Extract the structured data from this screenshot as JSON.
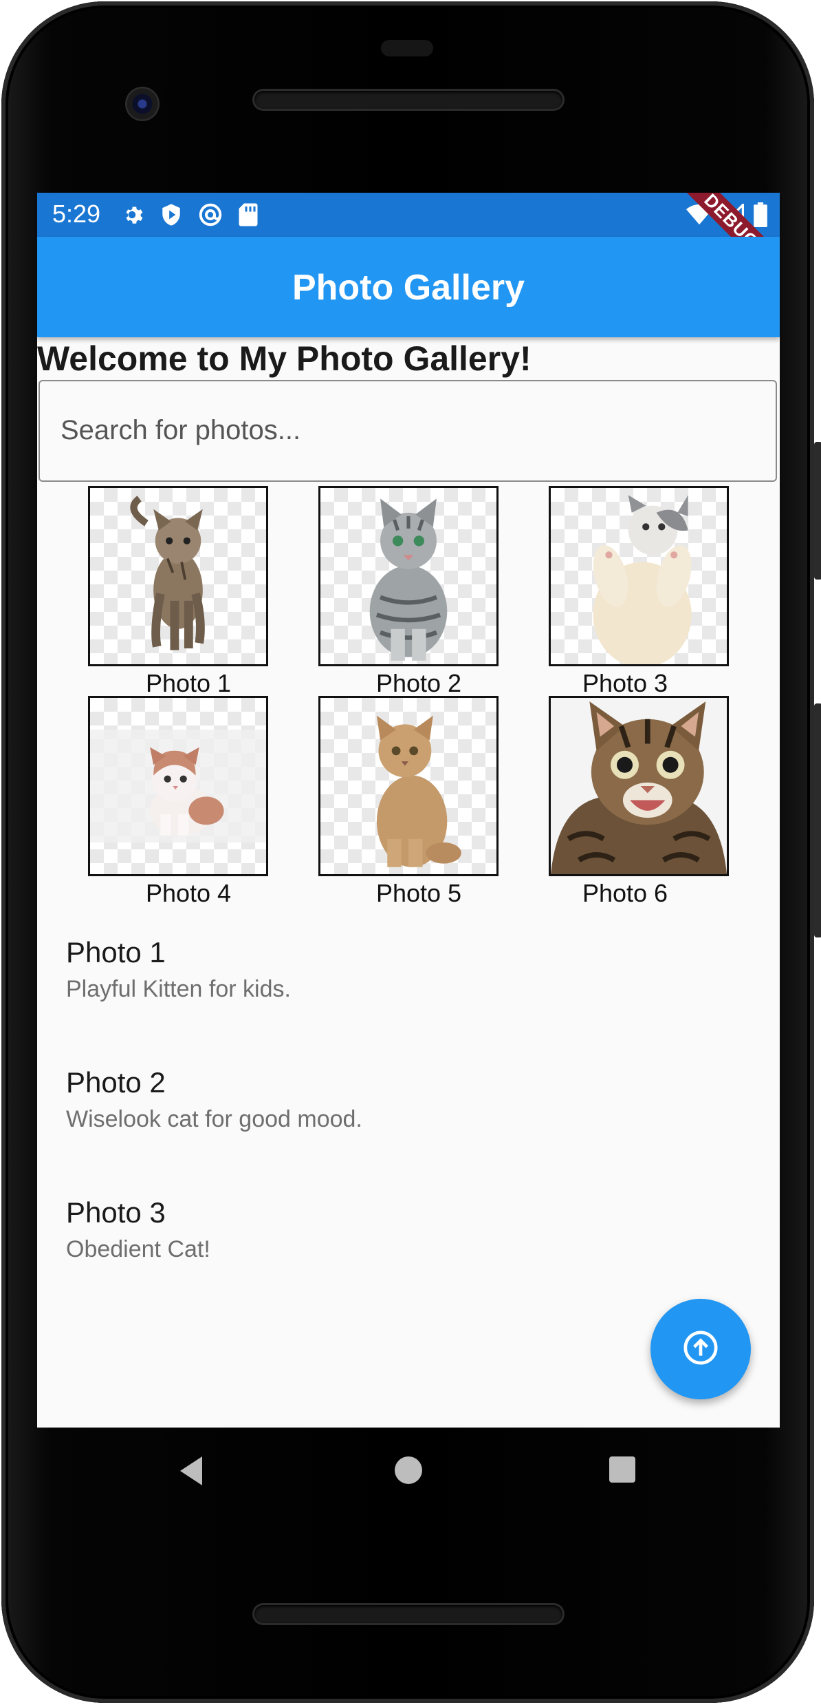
{
  "status_bar": {
    "time": "5:29",
    "left_icons": [
      "settings-gear-icon",
      "shield-play-icon",
      "at-sign-icon",
      "sd-card-icon"
    ],
    "right_icons": [
      "wifi-icon",
      "signal-icon",
      "battery-icon"
    ],
    "debug_label": "DEBUG",
    "color": "#1976d2"
  },
  "app_bar": {
    "title": "Photo Gallery",
    "color": "#2196f3"
  },
  "welcome_text": "Welcome to My Photo Gallery!",
  "search": {
    "placeholder": "Search for photos...",
    "value": ""
  },
  "gallery": [
    {
      "caption": "Photo 1",
      "image": "tabby-kitten-walking"
    },
    {
      "caption": "Photo 2",
      "image": "silver-tabby-cat-sitting"
    },
    {
      "caption": "Photo 3",
      "image": "white-grey-cat-reaching-up"
    },
    {
      "caption": "Photo 4",
      "image": "ginger-white-kitten"
    },
    {
      "caption": "Photo 5",
      "image": "cream-kitten-sitting"
    },
    {
      "caption": "Photo 6",
      "image": "smiling-tabby-cat"
    }
  ],
  "list": [
    {
      "title": "Photo 1",
      "subtitle": "Playful Kitten for kids."
    },
    {
      "title": "Photo 2",
      "subtitle": "Wiselook cat for good mood."
    },
    {
      "title": "Photo 3",
      "subtitle": "Obedient Cat!"
    }
  ],
  "fab": {
    "icon": "arrow-up-circle-icon"
  },
  "nav_bar": {
    "icons": [
      "back-triangle-icon",
      "home-circle-icon",
      "recents-square-icon"
    ]
  }
}
